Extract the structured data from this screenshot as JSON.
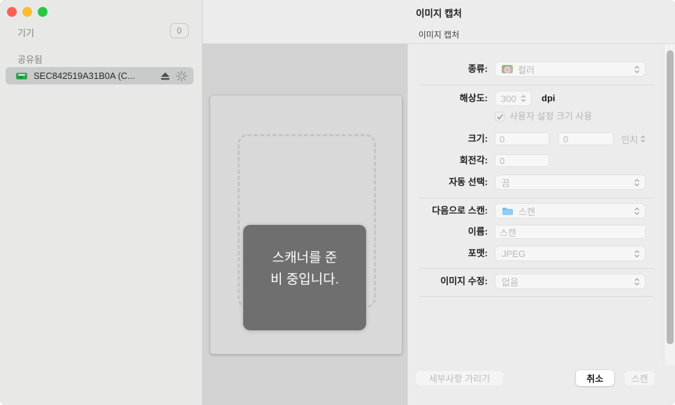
{
  "window": {
    "title": "이미지 캡처",
    "toolbar_title": "이미지 캡처"
  },
  "sidebar": {
    "devices_header": "기기",
    "devices_badge": "0",
    "shared_header": "공유됨",
    "shared_device": {
      "name": "SEC842519A31B0A (C...",
      "status": "busy-spinner"
    }
  },
  "preview": {
    "status_lines": [
      "스캐너를 준",
      "비 중입니다."
    ]
  },
  "form": {
    "kind": {
      "label": "종류:",
      "value": "컬러"
    },
    "resolution": {
      "label": "해상도:",
      "value": "300",
      "unit": "dpi"
    },
    "custom_size": {
      "label": "사용자 설정 크기 사용",
      "checked": true
    },
    "size": {
      "label": "크기:",
      "width": "0",
      "height": "0",
      "unit": "인치"
    },
    "rotation": {
      "label": "회전각:",
      "value": "0"
    },
    "auto_select": {
      "label": "자동 선택:",
      "value": "끔"
    },
    "scan_to": {
      "label": "다음으로 스캔:",
      "value": "스캔"
    },
    "name": {
      "label": "이름:",
      "value": "스캔"
    },
    "format": {
      "label": "포맷:",
      "value": "JPEG"
    },
    "image_correction": {
      "label": "이미지 수정:",
      "value": "없음"
    }
  },
  "buttons": {
    "hide_details": "세부사항 가리기",
    "cancel": "취소",
    "scan": "스캔"
  },
  "icons": {
    "traffic_close": "red-circle",
    "traffic_minimize": "yellow-circle",
    "traffic_zoom": "green-circle",
    "printer": "green-printer",
    "eject": "eject-triangle-bar",
    "spinner": "radial-spinner",
    "kind_thumbnail": "color-photo-flower",
    "folder": "blue-folder",
    "popup_stepper": "up-down-chevrons",
    "checkbox_check": "gray-checkmark"
  },
  "colors": {
    "traffic_red": "#FF5F57",
    "traffic_yellow": "#FEBC2E",
    "traffic_green": "#28C840",
    "overlay_gray": "#6F6F6F",
    "preview_bg": "#D2D2D2",
    "panel_bg": "#ECECEC"
  }
}
